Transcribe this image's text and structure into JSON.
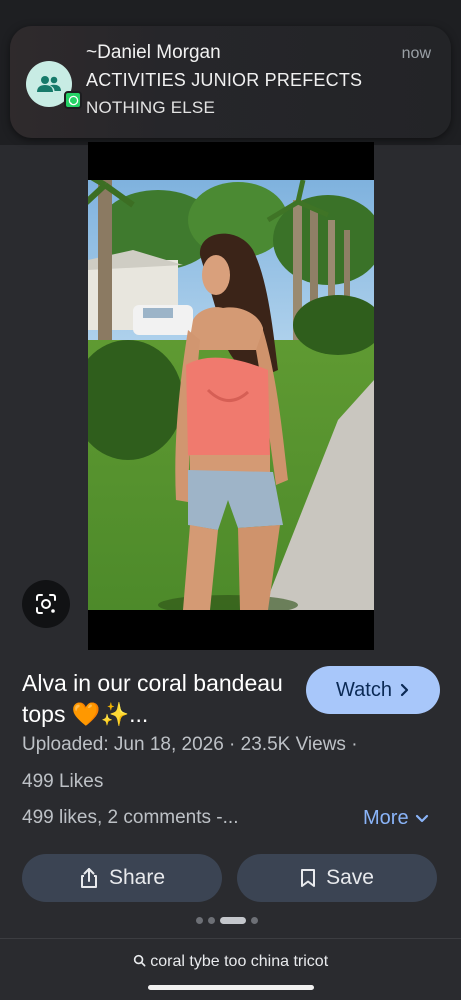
{
  "notification": {
    "sender": "~Daniel Morgan",
    "time": "now",
    "line1": "ACTIVITIES JUNIOR PREFECTS",
    "line2": "NOTHING ELSE",
    "avatar_icon": "group-icon",
    "app_badge_icon": "whatsapp-icon"
  },
  "media": {
    "lens_icon": "google-lens-icon"
  },
  "result": {
    "title": "Alva in our coral bandeau tops 🧡✨...",
    "watch_label": "Watch",
    "meta": "Uploaded: Jun 18, 2026 · 23.5K Views ·",
    "likes": "499 Likes",
    "comments": "499 likes, 2 comments -...",
    "more_label": "More"
  },
  "actions": {
    "share_label": "Share",
    "save_label": "Save"
  },
  "pagination": {
    "count": 4,
    "active_index": 2
  },
  "search": {
    "query": "coral tybe too china tricot"
  },
  "colors": {
    "background": "#2a2b2f",
    "accent_button": "#a8c7fa",
    "link": "#8ab4f8",
    "action_button": "#3b4453",
    "whatsapp_green": "#25d366"
  }
}
